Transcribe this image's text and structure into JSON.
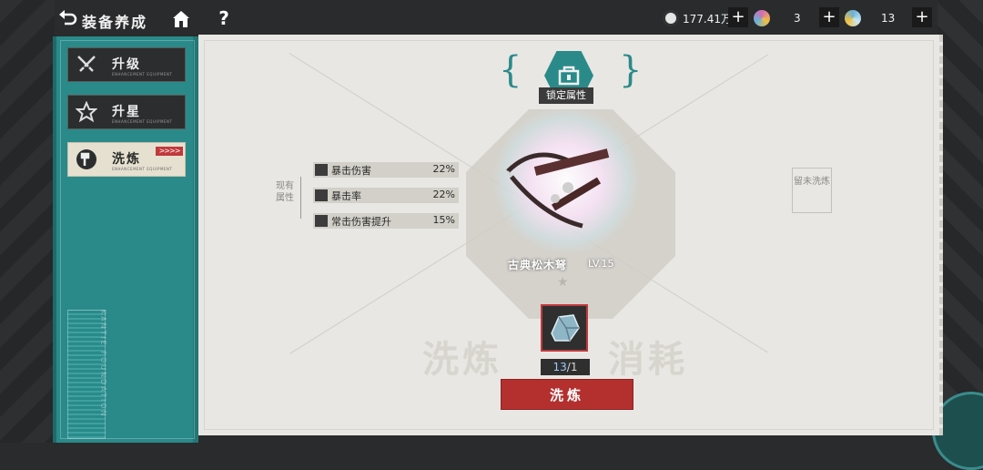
{
  "header": {
    "title": "装备养成",
    "help_label": "?"
  },
  "resources": [
    {
      "name": "coin-icon",
      "value": "177.41万",
      "color": "#d8d8d8"
    },
    {
      "name": "pink-gem-icon",
      "value": "3",
      "color": "#d56bb3"
    },
    {
      "name": "blue-gem-icon",
      "value": "13",
      "color": "#6ab0d8"
    }
  ],
  "plus_label": "+",
  "sidebar": {
    "tabs": [
      {
        "label": "升级",
        "sub": "ENHANCEMENT EQUIPMENT",
        "active": false,
        "icon": "swords-icon"
      },
      {
        "label": "升星",
        "sub": "ENHANCEMENT EQUIPMENT",
        "active": false,
        "icon": "star-icon"
      },
      {
        "label": "洗炼",
        "sub": "ENHANCEMENT EQUIPMENT",
        "active": true,
        "icon": "hammer-icon"
      }
    ],
    "active_marker": ">>>>",
    "footer_text": "KANTIE FOUNDATION"
  },
  "main": {
    "lock_label": "锁定属性",
    "current_attrs_label": "现有属性",
    "pending_label": "留未洗炼",
    "attributes": [
      {
        "name": "暴击伤害",
        "value": "22%"
      },
      {
        "name": "暴击率",
        "value": "22%"
      },
      {
        "name": "常击伤害提升",
        "value": "15%"
      }
    ],
    "weapon": {
      "name": "古典松木弩",
      "level": "LV.15"
    },
    "background_text_left": "洗炼",
    "background_text_right": "消耗",
    "material": {
      "have": "13",
      "need": "1",
      "separator": "/"
    },
    "refine_button": "洗炼"
  },
  "colors": {
    "accent_teal": "#2a8a8a",
    "accent_red": "#b3302f"
  }
}
